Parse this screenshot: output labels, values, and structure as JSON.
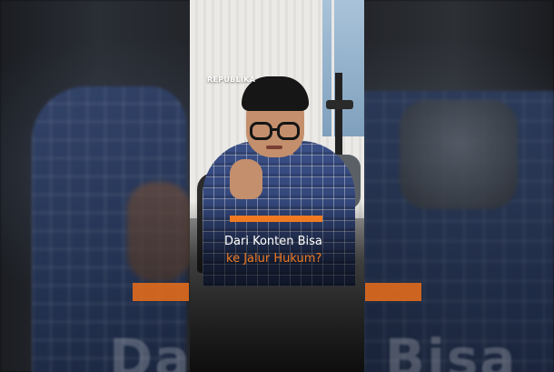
{
  "brand": {
    "logo_text": "REPUBLIKA"
  },
  "caption": {
    "line1": "Dari Konten Bisa",
    "line2": "ke Jalur Hukum?"
  },
  "background": {
    "echo_left": "Dari",
    "echo_right": "Bisa"
  },
  "colors": {
    "accent": "#f07a22",
    "caption_text": "#ffffff",
    "backdrop": "#0e0e10"
  }
}
